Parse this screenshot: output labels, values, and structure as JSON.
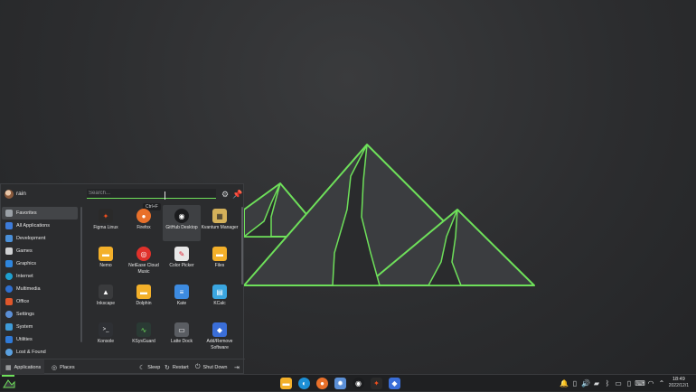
{
  "launcher": {
    "username": "rain",
    "search_placeholder": "Search...",
    "tooltip": "Ctrl+F",
    "categories": [
      {
        "label": "Favorites",
        "color": "#9aa0a6"
      },
      {
        "label": "All Applications",
        "color": "#3d7bd9"
      },
      {
        "label": "Development",
        "color": "#4a90d9"
      },
      {
        "label": "Games",
        "color": "#cfd1d3"
      },
      {
        "label": "Graphics",
        "color": "#2e86de"
      },
      {
        "label": "Internet",
        "color": "#1ea0d0"
      },
      {
        "label": "Multimedia",
        "color": "#2e6fd0"
      },
      {
        "label": "Office",
        "color": "#e0572b"
      },
      {
        "label": "Settings",
        "color": "#5b8fd6"
      },
      {
        "label": "System",
        "color": "#3e9bd8"
      },
      {
        "label": "Utilities",
        "color": "#2f7ad8"
      },
      {
        "label": "Lost & Found",
        "color": "#5aa0e0"
      }
    ],
    "apps": [
      {
        "label": "Figma Linux",
        "icon": "figma-icon",
        "color": "#2a2a2a",
        "glyph": "✦"
      },
      {
        "label": "Firefox",
        "icon": "firefox-icon",
        "color": "#e8702a",
        "glyph": "●"
      },
      {
        "label": "GitHub Desktop",
        "icon": "github-icon",
        "color": "#1b1c1e",
        "glyph": "◉"
      },
      {
        "label": "Kvantum Manager",
        "icon": "kvantum-icon",
        "color": "#d4b15a",
        "glyph": "▦"
      },
      {
        "label": "Nemo",
        "icon": "folder-icon",
        "color": "#f3b02a",
        "glyph": "▬"
      },
      {
        "label": "NetEase Cloud Music",
        "icon": "netease-music-icon",
        "color": "#e0312b",
        "glyph": "◎"
      },
      {
        "label": "Color Picker",
        "icon": "color-picker-icon",
        "color": "#e8e8e8",
        "glyph": "✎"
      },
      {
        "label": "Files",
        "icon": "folder-icon",
        "color": "#f3b02a",
        "glyph": "▬"
      },
      {
        "label": "Inkscape",
        "icon": "inkscape-icon",
        "color": "#3a3b3d",
        "glyph": "▲"
      },
      {
        "label": "Dolphin",
        "icon": "dolphin-folder-icon",
        "color": "#f3b02a",
        "glyph": "▬"
      },
      {
        "label": "Kate",
        "icon": "kate-icon",
        "color": "#3d8be0",
        "glyph": "≡"
      },
      {
        "label": "KCalc",
        "icon": "kcalc-icon",
        "color": "#3aa6e0",
        "glyph": "▤"
      },
      {
        "label": "Konsole",
        "icon": "konsole-icon",
        "color": "#2e3034",
        "glyph": ">_"
      },
      {
        "label": "KSysGuard",
        "icon": "ksysguard-icon",
        "color": "#2a3a34",
        "glyph": "∿"
      },
      {
        "label": "Latte Dock",
        "icon": "latte-dock-icon",
        "color": "#5a5d62",
        "glyph": "▭"
      },
      {
        "label": "Add/Remove Software",
        "icon": "discover-icon",
        "color": "#3a6ed8",
        "glyph": "◆"
      }
    ],
    "bottom": {
      "applications": "Applications",
      "places": "Places",
      "sleep": "Sleep",
      "restart": "Restart",
      "shutdown": "Shut Down"
    }
  },
  "taskbar": {
    "apps": [
      {
        "name": "files",
        "icon": "folder-icon",
        "color": "#f3b02a",
        "glyph": "▬"
      },
      {
        "name": "edge",
        "icon": "edge-icon",
        "color": "#1c8fd6",
        "glyph": "◐"
      },
      {
        "name": "firefox",
        "icon": "firefox-icon",
        "color": "#e8702a",
        "glyph": "●"
      },
      {
        "name": "settings",
        "icon": "settings-icon",
        "color": "#5b8fd6",
        "glyph": "✹"
      },
      {
        "name": "github",
        "icon": "github-icon",
        "color": "#1b1c1e",
        "glyph": "◉"
      },
      {
        "name": "figma",
        "icon": "figma-icon",
        "color": "#2a2a2a",
        "glyph": "✦"
      },
      {
        "name": "discover",
        "icon": "discover-icon",
        "color": "#3a6ed8",
        "glyph": "◆"
      }
    ],
    "time": "18:49",
    "date": "2022/12/1"
  },
  "colors": {
    "accent": "#6ee05a",
    "background": "#2c2d2f"
  }
}
